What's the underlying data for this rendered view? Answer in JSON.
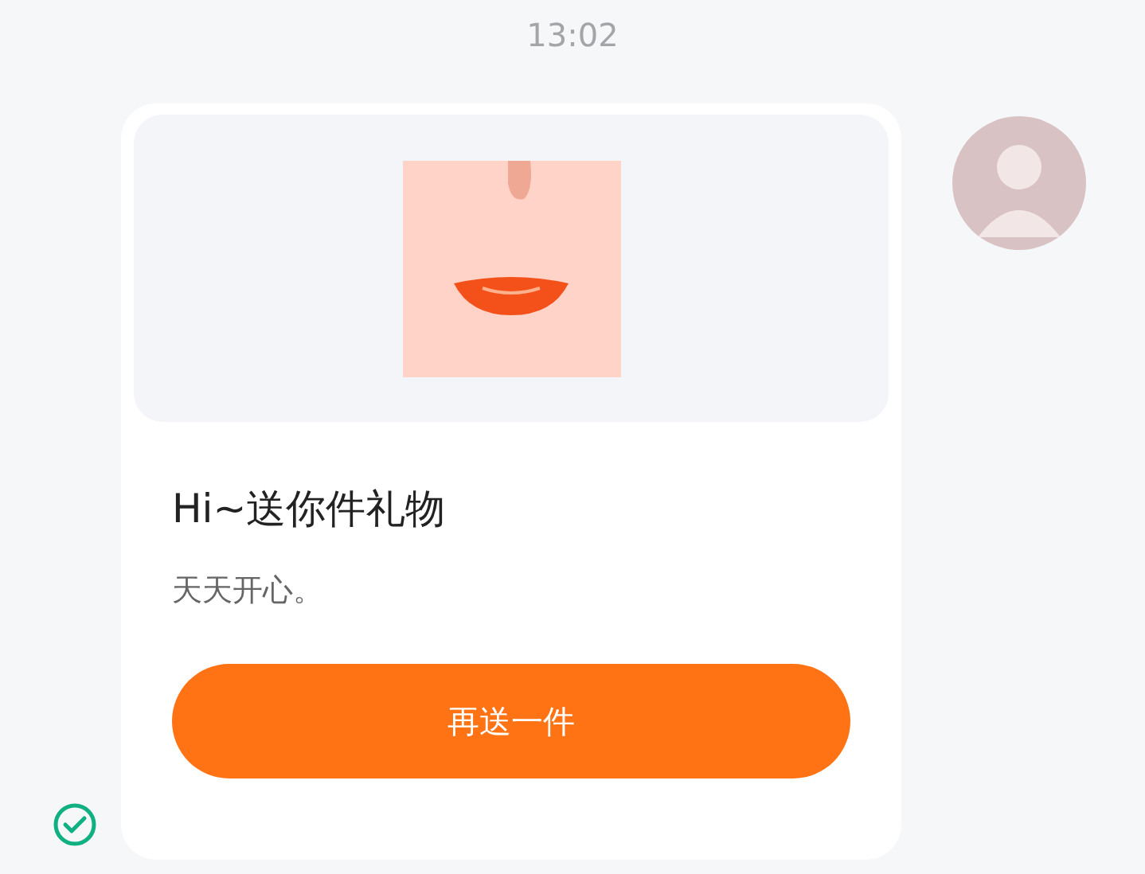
{
  "timestamp": "13:02",
  "message": {
    "read": true,
    "title": "Hi~送你件礼物",
    "text": "天天开心。",
    "button": "再送一件"
  }
}
